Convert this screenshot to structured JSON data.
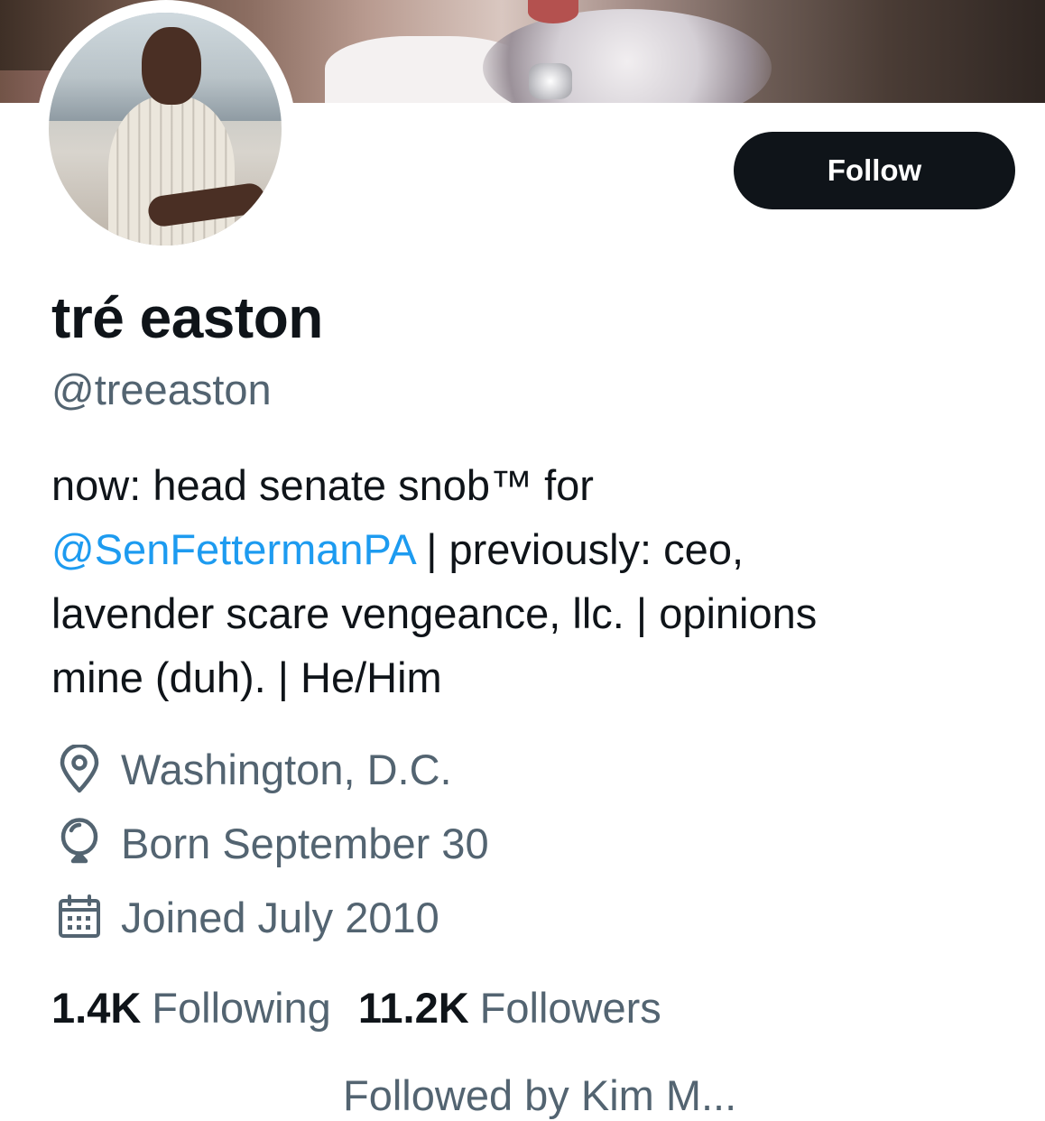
{
  "profile": {
    "display_name": "tré easton",
    "handle": "@treeaston",
    "follow_label": "Follow",
    "bio": {
      "line1": "now: head senate snob™ for",
      "mention": "@SenFettermanPA",
      "line2_rest": " | previously: ceo,",
      "line3": "lavender scare vengeance, llc. | opinions",
      "line4": "mine (duh). | He/Him"
    },
    "location": "Washington, D.C.",
    "birthday": "Born September 30",
    "joined": "Joined July 2010",
    "following_count": "1.4K",
    "following_label": "Following",
    "followers_count": "11.2K",
    "followers_label": "Followers",
    "followed_by_partial": "Followed by Kim M..."
  },
  "colors": {
    "text_primary": "#0f1419",
    "text_secondary": "#536471",
    "link": "#1d9bf0",
    "button_bg": "#0f1419"
  },
  "icons": {
    "location": "location-pin-icon",
    "birthday": "balloon-icon",
    "joined": "calendar-icon"
  }
}
